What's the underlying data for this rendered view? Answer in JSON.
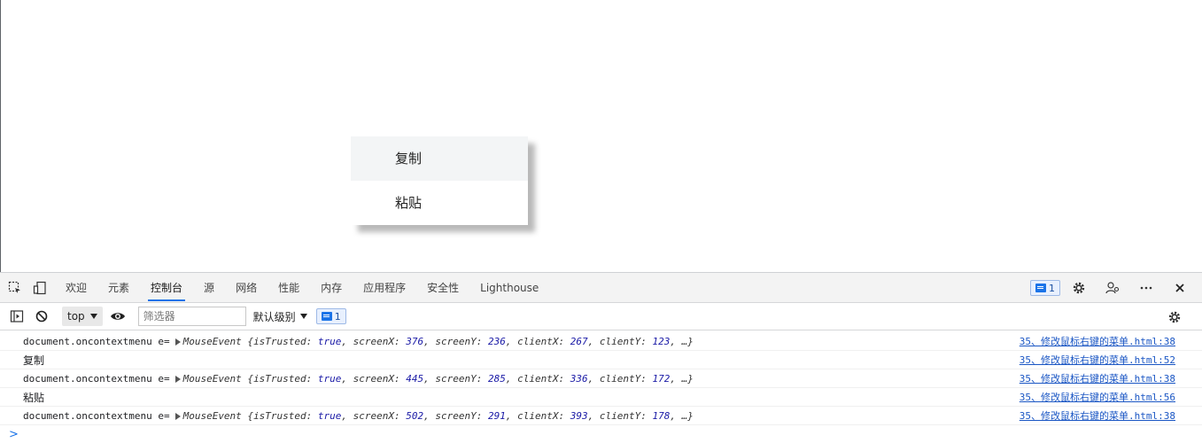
{
  "context_menu": {
    "items": [
      {
        "label": "复制"
      },
      {
        "label": "粘贴"
      }
    ]
  },
  "devtools": {
    "tabs": [
      {
        "label": "欢迎"
      },
      {
        "label": "元素"
      },
      {
        "label": "控制台"
      },
      {
        "label": "源"
      },
      {
        "label": "网络"
      },
      {
        "label": "性能"
      },
      {
        "label": "内存"
      },
      {
        "label": "应用程序"
      },
      {
        "label": "安全性"
      },
      {
        "label": "Lighthouse"
      }
    ],
    "active_tab": "控制台",
    "issues_count": "1",
    "accent_color": "#1a73e8"
  },
  "console_toolbar": {
    "context": "top",
    "filter_placeholder": "筛选器",
    "levels_label": "默认级别",
    "messages_count": "1"
  },
  "console": {
    "rows": [
      {
        "prefix": "document.oncontextmenu e=",
        "object": "MouseEvent",
        "open": " {",
        "props": [
          {
            "key": "isTrusted",
            "value": "true"
          },
          {
            "key": "screenX",
            "value": "376"
          },
          {
            "key": "screenY",
            "value": "236"
          },
          {
            "key": "clientX",
            "value": "267"
          },
          {
            "key": "clientY",
            "value": "123"
          }
        ],
        "tail": ", …}",
        "source": "35、修改鼠标右键的菜单.html:38"
      },
      {
        "plain": "复制",
        "source": "35、修改鼠标右键的菜单.html:52"
      },
      {
        "prefix": "document.oncontextmenu e=",
        "object": "MouseEvent",
        "open": " {",
        "props": [
          {
            "key": "isTrusted",
            "value": "true"
          },
          {
            "key": "screenX",
            "value": "445"
          },
          {
            "key": "screenY",
            "value": "285"
          },
          {
            "key": "clientX",
            "value": "336"
          },
          {
            "key": "clientY",
            "value": "172"
          }
        ],
        "tail": ", …}",
        "source": "35、修改鼠标右键的菜单.html:38"
      },
      {
        "plain": "粘贴",
        "source": "35、修改鼠标右键的菜单.html:56"
      },
      {
        "prefix": "document.oncontextmenu e=",
        "object": "MouseEvent",
        "open": " {",
        "props": [
          {
            "key": "isTrusted",
            "value": "true"
          },
          {
            "key": "screenX",
            "value": "502"
          },
          {
            "key": "screenY",
            "value": "291"
          },
          {
            "key": "clientX",
            "value": "393"
          },
          {
            "key": "clientY",
            "value": "178"
          }
        ],
        "tail": ", …}",
        "source": "35、修改鼠标右键的菜单.html:38"
      }
    ],
    "prompt_symbol": ">"
  }
}
